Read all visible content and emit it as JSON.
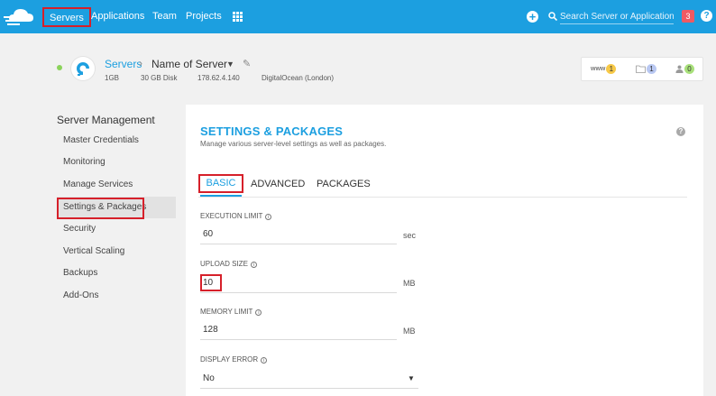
{
  "nav": {
    "items": [
      {
        "label": "Servers",
        "active": true
      },
      {
        "label": "Applications"
      },
      {
        "label": "Team"
      },
      {
        "label": "Projects"
      }
    ],
    "search_placeholder": "Search Server or Application",
    "notification_count": "3",
    "help_label": "?"
  },
  "server": {
    "breadcrumb_root": "Servers",
    "name": "Name of Server",
    "ram": "1GB",
    "disk": "30 GB Disk",
    "ip": "178.62.4.140",
    "provider": "DigitalOcean (London)",
    "counters": {
      "www_label": "www",
      "www_count": "1",
      "files_count": "1",
      "users_count": "0"
    }
  },
  "sidebar": {
    "title": "Server Management",
    "items": [
      {
        "label": "Master Credentials"
      },
      {
        "label": "Monitoring"
      },
      {
        "label": "Manage Services"
      },
      {
        "label": "Settings & Packages",
        "active": true
      },
      {
        "label": "Security"
      },
      {
        "label": "Vertical Scaling"
      },
      {
        "label": "Backups"
      },
      {
        "label": "Add-Ons"
      }
    ]
  },
  "panel": {
    "title": "SETTINGS & PACKAGES",
    "subtitle": "Manage various server-level settings as well as packages.",
    "help_label": "?",
    "tabs": [
      {
        "label": "BASIC",
        "active": true
      },
      {
        "label": "ADVANCED"
      },
      {
        "label": "PACKAGES"
      }
    ],
    "fields": {
      "execution_limit": {
        "label": "EXECUTION LIMIT",
        "value": "60",
        "unit": "sec"
      },
      "upload_size": {
        "label": "UPLOAD SIZE",
        "value": "10",
        "unit": "MB"
      },
      "memory_limit": {
        "label": "MEMORY LIMIT",
        "value": "128",
        "unit": "MB"
      },
      "display_error": {
        "label": "DISPLAY ERROR",
        "value": "No"
      }
    }
  },
  "colors": {
    "brand": "#1c9fe0",
    "highlight": "#d6202a",
    "status_online": "#8bd35b"
  }
}
